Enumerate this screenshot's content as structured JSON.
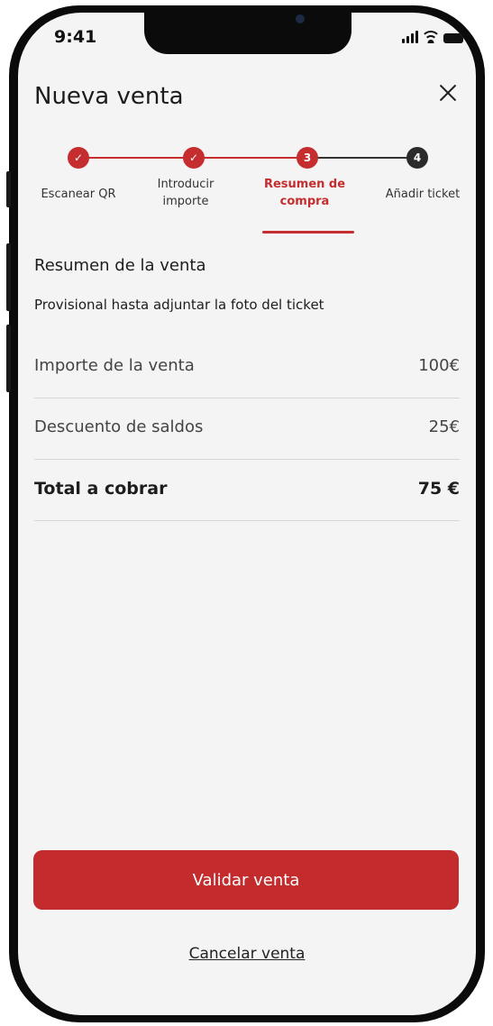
{
  "status_bar": {
    "time": "9:41"
  },
  "header": {
    "title": "Nueva venta",
    "close_icon": "close-icon"
  },
  "stepper": {
    "steps": [
      {
        "number": "✓",
        "label": "Escanear QR",
        "state": "done"
      },
      {
        "number": "✓",
        "label": "Introducir importe",
        "state": "done"
      },
      {
        "number": "3",
        "label": "Resumen de compra",
        "state": "active"
      },
      {
        "number": "4",
        "label": "Añadir ticket",
        "state": "pending"
      }
    ]
  },
  "summary": {
    "title": "Resumen de la venta",
    "subtitle": "Provisional hasta adjuntar la foto del ticket",
    "rows": [
      {
        "label": "Importe de la venta",
        "value": "100€"
      },
      {
        "label": "Descuento de saldos",
        "value": "25€"
      },
      {
        "label": "Total a cobrar",
        "value": "75 €"
      }
    ]
  },
  "actions": {
    "validate_label": "Validar venta",
    "cancel_label": "Cancelar venta"
  },
  "colors": {
    "accent": "#c42b2d",
    "pending_step": "#2b2b2b",
    "background": "#f4f4f4"
  }
}
